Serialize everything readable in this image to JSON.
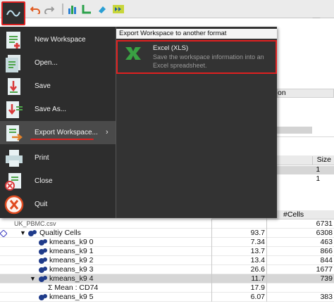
{
  "toolbar": {
    "icons": [
      "app-logo-icon",
      "undo-icon",
      "redo-icon",
      "bar-chart-icon",
      "axis-icon",
      "eraser-icon",
      "fast-forward-icon"
    ]
  },
  "header_right": {
    "icons": [
      "heart-icon",
      "help-icon",
      "add-document-icon"
    ]
  },
  "menu": {
    "items": [
      {
        "label": "New Workspace",
        "icon": "new-workspace-icon"
      },
      {
        "label": "Open...",
        "icon": "open-icon"
      },
      {
        "label": "Save",
        "icon": "save-icon"
      },
      {
        "label": "Save As...",
        "icon": "save-as-icon"
      },
      {
        "label": "Export Workspace...",
        "icon": "export-icon"
      },
      {
        "label": "Print",
        "icon": "print-icon"
      },
      {
        "label": "Close",
        "icon": "close-workspace-icon"
      },
      {
        "label": "Quit",
        "icon": "quit-icon"
      }
    ],
    "submenu_arrow": "›"
  },
  "submenu": {
    "header": "Export Workspace to another format",
    "item": {
      "title": "Excel (XLS)",
      "description": "Save the workspace information into an Excel spreadsheet."
    }
  },
  "background": {
    "partial_labels": {
      "col_on": "on",
      "col_size": "Size",
      "col_cells": "#Cells",
      "row1_size": "1",
      "row2_size": "1",
      "fcs_cells": "6731",
      "file_label": "UK_PBMC.csv"
    },
    "tree": [
      {
        "label": "Qualtiy Cells",
        "value": "93.7",
        "cells": "6308"
      },
      {
        "label": "kmeans_k9 0",
        "value": "7.34",
        "cells": "463"
      },
      {
        "label": "kmeans_k9 1",
        "value": "13.7",
        "cells": "866"
      },
      {
        "label": "kmeans_k9 2",
        "value": "13.4",
        "cells": "844"
      },
      {
        "label": "kmeans_k9 3",
        "value": "26.6",
        "cells": "1677"
      },
      {
        "label": "kmeans_k9 4",
        "value": "11.7",
        "cells": "739"
      },
      {
        "label": "Σ Mean : CD74",
        "value": "17.9",
        "cells": ""
      },
      {
        "label": "kmeans_k9 5",
        "value": "6.07",
        "cells": "383"
      }
    ]
  },
  "colors": {
    "accent_red": "#e02020",
    "menu_bg": "#2d2d2d",
    "excel_green": "#3aa043"
  }
}
